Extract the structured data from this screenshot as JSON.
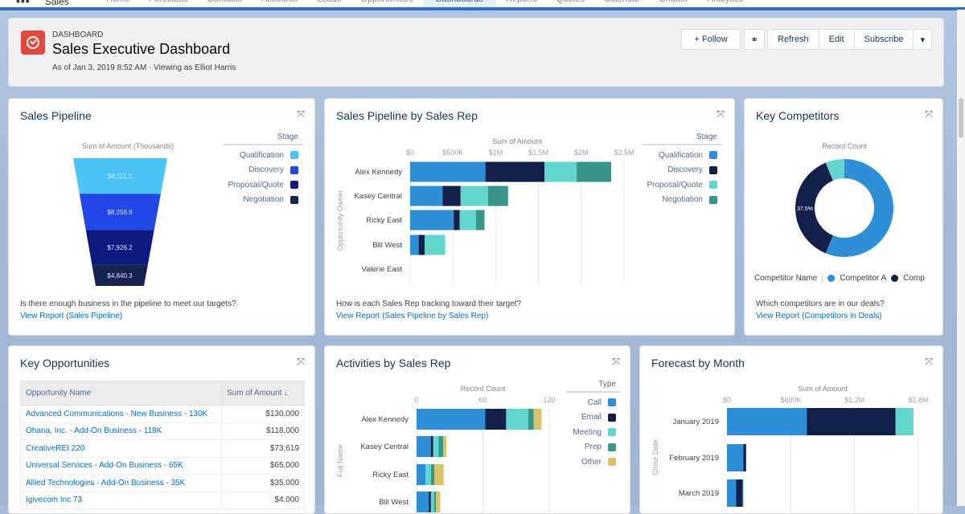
{
  "nav": {
    "app_name": "Sales",
    "items": [
      "Home",
      "Forecasts",
      "Contacts",
      "Accounts",
      "Leads",
      "Opportunities",
      "Dashboards",
      "Reports",
      "Quotes",
      "Calendar",
      "Chatter",
      "Analytics"
    ],
    "active": "Dashboards"
  },
  "header": {
    "kicker": "DASHBOARD",
    "title": "Sales Executive Dashboard",
    "subtitle": "As of Jan 3, 2019 8:52 AM · Viewing as Elliot Harris",
    "follow": "+ Follow",
    "refresh": "Refresh",
    "edit": "Edit",
    "subscribe": "Subscribe",
    "more": "▾"
  },
  "colors": {
    "qualification": "#4bc3f4",
    "discovery": "#2148e6",
    "proposal": "#0c1a80",
    "negotiation": "#16244f",
    "blue": "#2e8ed8",
    "navy": "#13204a",
    "teal": "#62d6cc",
    "green": "#379688",
    "gold": "#d9c36a"
  },
  "panels": {
    "sales_pipeline": {
      "title": "Sales Pipeline",
      "question": "Is there enough business in the pipeline to meet our targets?",
      "link": "View Report (Sales Pipeline)"
    },
    "pipeline_by_rep": {
      "title": "Sales Pipeline by Sales Rep",
      "question": "How is each Sales Rep tracking toward their target?",
      "link": "View Report (Sales Pipeline by Sales Rep)"
    },
    "key_competitors": {
      "title": "Key Competitors",
      "question": "Which competitors are in our deals?",
      "link": "View Report (Competitors in Deals)"
    },
    "key_opportunities": {
      "title": "Key Opportunities",
      "columns": [
        "Opportunity Name",
        "Sum of Amount ↓"
      ],
      "rows": [
        [
          "Advanced Communications - New Business - 130K",
          "$130,000"
        ],
        [
          "Ohana, Inc. - Add-On Business - 118K",
          "$118,000"
        ],
        [
          "CreativeREI 220",
          "$73,619"
        ],
        [
          "Universal Services - Add-On Business - 65K",
          "$65,000"
        ],
        [
          "Allied Technologies - Add-On Business - 35K",
          "$35,000"
        ],
        [
          "Igivecom Inc 73",
          "$4,000"
        ]
      ]
    },
    "activities": {
      "title": "Activities by Sales Rep"
    },
    "forecast": {
      "title": "Forecast by Month"
    }
  },
  "chart_data": [
    {
      "type": "funnel",
      "title": "Sum of Amount (Thousands)",
      "legend_title": "Stage",
      "categories": [
        "Qualification",
        "Discovery",
        "Proposal/Quote",
        "Negotiation"
      ],
      "values": [
        8111.1,
        8256.9,
        7926.2,
        4840.3
      ],
      "labels": [
        "$8,111.1",
        "$8,256.9",
        "$7,926.2",
        "$4,840.3"
      ],
      "colors": [
        "#4bc3f4",
        "#2148e6",
        "#0c1a80",
        "#16244f"
      ]
    },
    {
      "type": "bar",
      "stacked": true,
      "orientation": "horizontal",
      "xlabel": "Sum of Amount",
      "ylabel": "Opportunity Owner",
      "legend_title": "Stage",
      "xlim": [
        0,
        2500000
      ],
      "ticks": [
        "$0",
        "$500K",
        "$1M",
        "$1.5M",
        "$2M",
        "$2.5M"
      ],
      "categories": [
        "Alex Kennedy",
        "Kasey Central",
        "Ricky East",
        "Bill West",
        "Valerie East"
      ],
      "series": [
        {
          "name": "Qualification",
          "color": "#2e8ed8",
          "values": [
            880000,
            380000,
            510000,
            100000,
            0
          ]
        },
        {
          "name": "Discovery",
          "color": "#13204a",
          "values": [
            690000,
            210000,
            70000,
            70000,
            0
          ]
        },
        {
          "name": "Proposal/Quote",
          "color": "#62d6cc",
          "values": [
            375000,
            320000,
            190000,
            240000,
            0
          ]
        },
        {
          "name": "Negotiation",
          "color": "#379688",
          "values": [
            405000,
            235000,
            100000,
            0,
            0
          ]
        }
      ]
    },
    {
      "type": "donut",
      "title": "Record Count",
      "legend_title": "Competitor Name",
      "slices": [
        {
          "name": "Competitor A",
          "value": 56.25,
          "color": "#2e8ed8"
        },
        {
          "name": "Comp",
          "value": 37.5,
          "color": "#13204a",
          "label": "37.5%"
        },
        {
          "name": "",
          "value": 6.25,
          "color": "#62d6cc"
        }
      ]
    },
    {
      "type": "bar",
      "stacked": true,
      "orientation": "horizontal",
      "xlabel": "Record Count",
      "ylabel": "Full Name",
      "legend_title": "Type",
      "xlim": [
        0,
        120
      ],
      "ticks": [
        "0",
        "60",
        "120"
      ],
      "categories": [
        "Alex Kennedy",
        "Kasey Central",
        "Ricky East",
        "Bill West"
      ],
      "series": [
        {
          "name": "Call",
          "color": "#2e8ed8",
          "values": [
            62,
            13,
            8,
            11
          ]
        },
        {
          "name": "Email",
          "color": "#13204a",
          "values": [
            19,
            2,
            0,
            2
          ]
        },
        {
          "name": "Meeting",
          "color": "#62d6cc",
          "values": [
            20,
            5,
            5,
            3
          ]
        },
        {
          "name": "Prep",
          "color": "#379688",
          "values": [
            5,
            4,
            3,
            1.5
          ]
        },
        {
          "name": "Other",
          "color": "#d9c36a",
          "values": [
            7,
            3,
            8.5,
            4
          ]
        }
      ]
    },
    {
      "type": "bar",
      "stacked": true,
      "orientation": "horizontal",
      "xlabel": "Sum of Amount",
      "ylabel": "Close Date",
      "xlim": [
        0,
        1800000
      ],
      "ticks": [
        "$0",
        "$600K",
        "$1.2M",
        "$1.8M"
      ],
      "categories": [
        "January 2019",
        "February 2019",
        "March 2019"
      ],
      "series": [
        {
          "color": "#2e8ed8",
          "values": [
            750000,
            155000,
            85000
          ]
        },
        {
          "color": "#13204a",
          "values": [
            836000,
            25000,
            63000
          ]
        },
        {
          "color": "#62d6cc",
          "values": [
            168000,
            0,
            8000
          ]
        }
      ]
    }
  ]
}
